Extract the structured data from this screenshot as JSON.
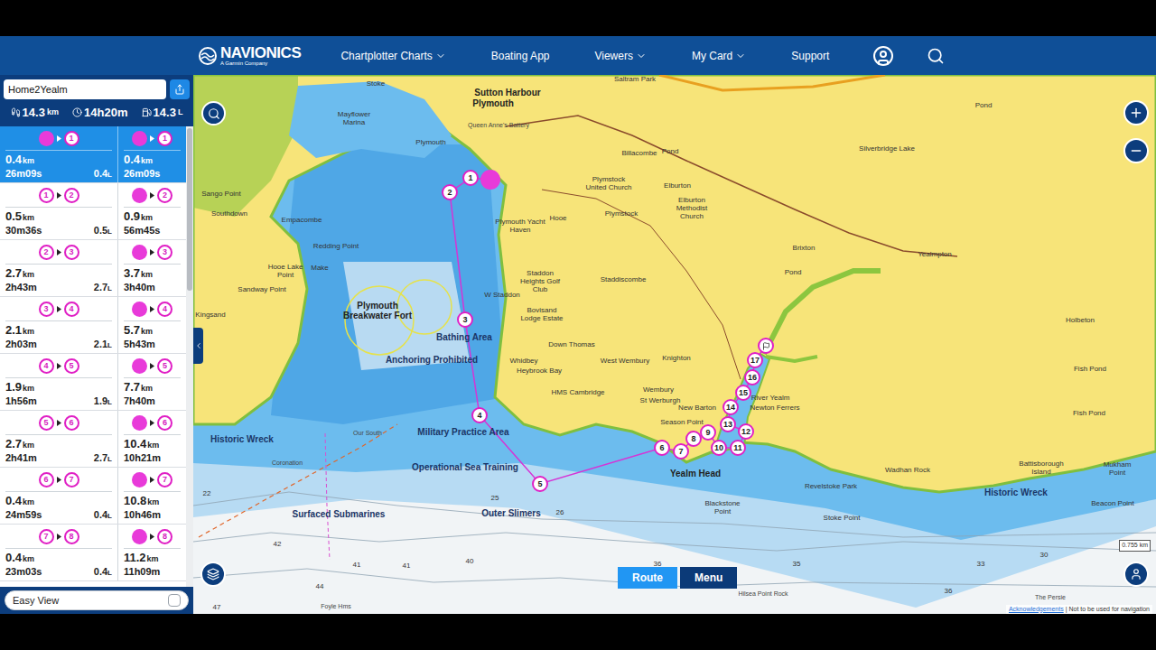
{
  "header": {
    "brand": "NAVIONICS",
    "brand_sub": "A Garmin Company",
    "menu": [
      {
        "label": "Chartplotter Charts",
        "dropdown": true
      },
      {
        "label": "Boating App",
        "dropdown": false
      },
      {
        "label": "Viewers",
        "dropdown": true
      },
      {
        "label": "My Card",
        "dropdown": true
      },
      {
        "label": "Support",
        "dropdown": false
      }
    ]
  },
  "route": {
    "name": "Home2Yealm",
    "total_distance": "14.3",
    "total_distance_unit": "km",
    "total_time": "14h20m",
    "total_fuel": "14.3",
    "total_fuel_unit": "L"
  },
  "legs": [
    {
      "from": {
        "kind": "start"
      },
      "to": "1",
      "dist": "0.4",
      "dist_unit": "km",
      "time": "26m09s",
      "fuel": "0.4",
      "fuel_unit": "L",
      "cum_dist": "0.4",
      "cum_dist_unit": "km",
      "cum_time": "26m09s",
      "selected": true
    },
    {
      "from": {
        "kind": "waypoint",
        "label": "1"
      },
      "to": "2",
      "dist": "0.5",
      "dist_unit": "km",
      "time": "30m36s",
      "fuel": "0.5",
      "fuel_unit": "L",
      "cum_dist": "0.9",
      "cum_dist_unit": "km",
      "cum_time": "56m45s",
      "selected": false
    },
    {
      "from": {
        "kind": "waypoint",
        "label": "2"
      },
      "to": "3",
      "dist": "2.7",
      "dist_unit": "km",
      "time": "2h43m",
      "fuel": "2.7",
      "fuel_unit": "L",
      "cum_dist": "3.7",
      "cum_dist_unit": "km",
      "cum_time": "3h40m",
      "selected": false
    },
    {
      "from": {
        "kind": "waypoint",
        "label": "3"
      },
      "to": "4",
      "dist": "2.1",
      "dist_unit": "km",
      "time": "2h03m",
      "fuel": "2.1",
      "fuel_unit": "L",
      "cum_dist": "5.7",
      "cum_dist_unit": "km",
      "cum_time": "5h43m",
      "selected": false
    },
    {
      "from": {
        "kind": "waypoint",
        "label": "4"
      },
      "to": "5",
      "dist": "1.9",
      "dist_unit": "km",
      "time": "1h56m",
      "fuel": "1.9",
      "fuel_unit": "L",
      "cum_dist": "7.7",
      "cum_dist_unit": "km",
      "cum_time": "7h40m",
      "selected": false
    },
    {
      "from": {
        "kind": "waypoint",
        "label": "5"
      },
      "to": "6",
      "dist": "2.7",
      "dist_unit": "km",
      "time": "2h41m",
      "fuel": "2.7",
      "fuel_unit": "L",
      "cum_dist": "10.4",
      "cum_dist_unit": "km",
      "cum_time": "10h21m",
      "selected": false
    },
    {
      "from": {
        "kind": "waypoint",
        "label": "6"
      },
      "to": "7",
      "dist": "0.4",
      "dist_unit": "km",
      "time": "24m59s",
      "fuel": "0.4",
      "fuel_unit": "L",
      "cum_dist": "10.8",
      "cum_dist_unit": "km",
      "cum_time": "10h46m",
      "selected": false
    },
    {
      "from": {
        "kind": "waypoint",
        "label": "7"
      },
      "to": "8",
      "dist": "0.4",
      "dist_unit": "km",
      "time": "23m03s",
      "fuel": "0.4",
      "fuel_unit": "L",
      "cum_dist": "11.2",
      "cum_dist_unit": "km",
      "cum_time": "11h09m",
      "selected": false
    }
  ],
  "easy_view": {
    "label": "Easy View",
    "checked": false
  },
  "map": {
    "waypoints": [
      {
        "label": "1"
      },
      {
        "label": "2"
      },
      {
        "label": "3"
      },
      {
        "label": "4"
      },
      {
        "label": "5"
      },
      {
        "label": "6"
      },
      {
        "label": "7"
      },
      {
        "label": "8"
      },
      {
        "label": "9"
      },
      {
        "label": "10"
      },
      {
        "label": "11"
      },
      {
        "label": "12"
      },
      {
        "label": "13"
      },
      {
        "label": "14"
      },
      {
        "label": "15"
      },
      {
        "label": "16"
      },
      {
        "label": "17"
      }
    ],
    "labels": [
      {
        "text": "Stoke",
        "kind": "place"
      },
      {
        "text": "Sutton Harbour",
        "kind": "town"
      },
      {
        "text": "Plymouth",
        "kind": "town"
      },
      {
        "text": "Queen Anne's Battery",
        "kind": "small"
      },
      {
        "text": "Saltram Park",
        "kind": "place"
      },
      {
        "text": "Mayflower Marina",
        "kind": "block"
      },
      {
        "text": "Plymouth",
        "kind": "place"
      },
      {
        "text": "Billacombe",
        "kind": "place"
      },
      {
        "text": "Pond",
        "kind": "place"
      },
      {
        "text": "Plymstock United Church",
        "kind": "block"
      },
      {
        "text": "Elburton",
        "kind": "place"
      },
      {
        "text": "Elburton Methodist Church",
        "kind": "block"
      },
      {
        "text": "Plymstock",
        "kind": "place"
      },
      {
        "text": "Silverbridge Lake",
        "kind": "place"
      },
      {
        "text": "Pond",
        "kind": "place"
      },
      {
        "text": "Brixton",
        "kind": "place"
      },
      {
        "text": "Yealmpton",
        "kind": "place"
      },
      {
        "text": "Pond",
        "kind": "place"
      },
      {
        "text": "Hooe",
        "kind": "place"
      },
      {
        "text": "Plymouth Yacht Haven",
        "kind": "block"
      },
      {
        "text": "Staddon Heights Golf Club",
        "kind": "block"
      },
      {
        "text": "Staddiscombe",
        "kind": "place"
      },
      {
        "text": "W Staddon",
        "kind": "place"
      },
      {
        "text": "Bovisand Lodge Estate",
        "kind": "block"
      },
      {
        "text": "Down Thomas",
        "kind": "place"
      },
      {
        "text": "West Wembury",
        "kind": "place"
      },
      {
        "text": "Knighton",
        "kind": "place"
      },
      {
        "text": "Whidbey",
        "kind": "place"
      },
      {
        "text": "Heybrook Bay",
        "kind": "place"
      },
      {
        "text": "HMS Cambridge",
        "kind": "place"
      },
      {
        "text": "Wembury",
        "kind": "place"
      },
      {
        "text": "St Werburgh",
        "kind": "place"
      },
      {
        "text": "New Barton",
        "kind": "place"
      },
      {
        "text": "Season Point",
        "kind": "block"
      },
      {
        "text": "River Yealm",
        "kind": "place"
      },
      {
        "text": "Newton Ferrers",
        "kind": "place"
      },
      {
        "text": "Yealm Head",
        "kind": "townblock"
      },
      {
        "text": "Blackstone Point",
        "kind": "block"
      },
      {
        "text": "Revelstoke Park",
        "kind": "place"
      },
      {
        "text": "Stoke Point",
        "kind": "block"
      },
      {
        "text": "Holbeton",
        "kind": "place"
      },
      {
        "text": "Fish Pond",
        "kind": "place"
      },
      {
        "text": "Fish Pond",
        "kind": "place"
      },
      {
        "text": "Wadhan Rock",
        "kind": "block"
      },
      {
        "text": "Battisborough Island",
        "kind": "block"
      },
      {
        "text": "Mukham Point",
        "kind": "block"
      },
      {
        "text": "Beacon Point",
        "kind": "block"
      },
      {
        "text": "Historic Wreck",
        "kind": "area"
      },
      {
        "text": "Sango Point",
        "kind": "block"
      },
      {
        "text": "Southdown",
        "kind": "place"
      },
      {
        "text": "Empacombe",
        "kind": "place"
      },
      {
        "text": "Redding Point",
        "kind": "block"
      },
      {
        "text": "Hooe Lake Point",
        "kind": "block"
      },
      {
        "text": "Make",
        "kind": "place"
      },
      {
        "text": "Sandway Point",
        "kind": "block"
      },
      {
        "text": "Kingsand",
        "kind": "place"
      },
      {
        "text": "Plymouth Breakwater Fort",
        "kind": "townblock"
      },
      {
        "text": "Bathing Area",
        "kind": "area"
      },
      {
        "text": "Anchoring Prohibited",
        "kind": "area"
      },
      {
        "text": "Military Practice Area",
        "kind": "area"
      },
      {
        "text": "Operational Sea Training",
        "kind": "area"
      },
      {
        "text": "Historic Wreck",
        "kind": "area"
      },
      {
        "text": "Outer Slimers",
        "kind": "area"
      },
      {
        "text": "Surfaced Submarines",
        "kind": "area"
      },
      {
        "text": "Coronation",
        "kind": "small"
      },
      {
        "text": "Our South",
        "kind": "small"
      },
      {
        "text": "Hilsea Point Rock",
        "kind": "small"
      },
      {
        "text": "The Persie",
        "kind": "small"
      },
      {
        "text": "Foyle Hms",
        "kind": "small"
      }
    ],
    "soundings": [
      "42",
      "41",
      "41",
      "40",
      "26",
      "25",
      "22",
      "47",
      "44",
      "36",
      "35",
      "33",
      "30",
      "36"
    ],
    "buttons": [
      {
        "label": "Route",
        "selected": true
      },
      {
        "label": "Menu",
        "selected": false
      }
    ],
    "scale": "0.755 km",
    "footer": {
      "link": "Acknowledgements",
      "separator": "|",
      "note": "Not to be used for navigation"
    }
  }
}
